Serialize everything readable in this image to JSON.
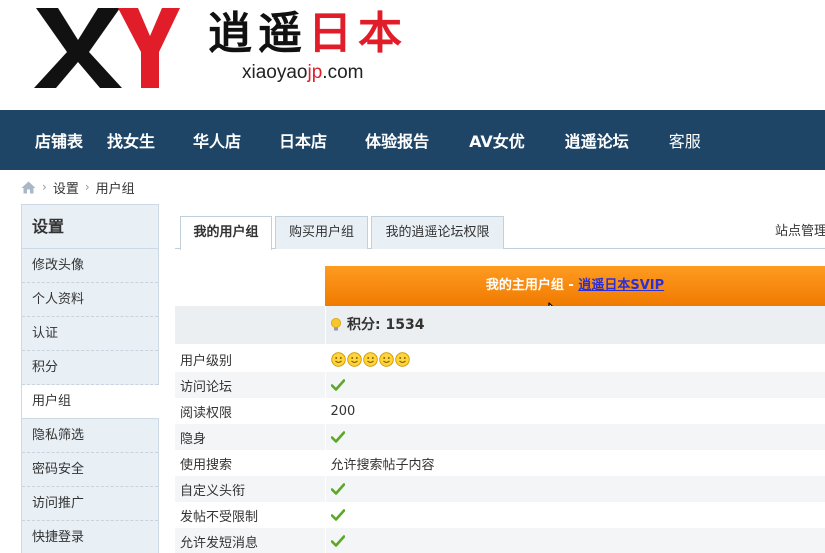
{
  "logo": {
    "mark": "XY",
    "name_black": "逍遥",
    "name_red": "日本",
    "domain_pre": "xiaoyao",
    "domain_red": "jp",
    "domain_post": ".com"
  },
  "nav": {
    "items": [
      "店铺表",
      "找女生",
      "华人店",
      "日本店",
      "体验报告",
      "AV女优",
      "逍遥论坛",
      "客服"
    ]
  },
  "breadcrumb": {
    "home_icon": "home-icon",
    "items": [
      "设置",
      "用户组"
    ]
  },
  "sidebar": {
    "title": "设置",
    "items": [
      "修改头像",
      "个人资料",
      "认证",
      "积分",
      "用户组",
      "隐私筛选",
      "密码安全",
      "访问推广",
      "快捷登录"
    ],
    "active": "用户组"
  },
  "tabs": {
    "items": [
      "我的用户组",
      "购买用户组",
      "我的逍遥论坛权限"
    ],
    "active": "我的用户组",
    "admin": "站点管理"
  },
  "group": {
    "header_prefix": "我的主用户组 - ",
    "header_link": "逍遥日本SVIP",
    "points_label": "积分: 1534"
  },
  "permissions": {
    "rows": [
      {
        "label": "用户级别",
        "value": "",
        "type": "smiles",
        "count": 5
      },
      {
        "label": "访问论坛",
        "value": "",
        "type": "check"
      },
      {
        "label": "阅读权限",
        "value": "200",
        "type": "text"
      },
      {
        "label": "隐身",
        "value": "",
        "type": "check"
      },
      {
        "label": "使用搜索",
        "value": "允许搜索帖子内容",
        "type": "text"
      },
      {
        "label": "自定义头衔",
        "value": "",
        "type": "check"
      },
      {
        "label": "发帖不受限制",
        "value": "",
        "type": "check"
      },
      {
        "label": "允许发短消息",
        "value": "",
        "type": "check"
      }
    ]
  },
  "colors": {
    "nav_bg": "#1e4466",
    "accent_red": "#e11d2a",
    "group_header": "#f58a0f",
    "check_green": "#5aa823"
  }
}
